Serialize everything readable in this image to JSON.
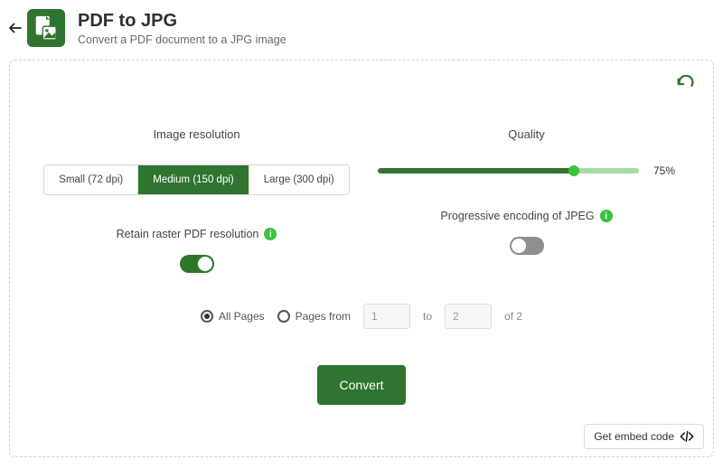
{
  "header": {
    "title": "PDF to JPG",
    "subtitle": "Convert a PDF document to a JPG image"
  },
  "resolution": {
    "label": "Image resolution",
    "options": [
      "Small (72 dpi)",
      "Medium (150 dpi)",
      "Large (300 dpi)"
    ],
    "selected_index": 1,
    "retain_label": "Retain raster PDF resolution",
    "retain_on": true
  },
  "quality": {
    "label": "Quality",
    "percent": 75,
    "percent_display": "75%",
    "progressive_label": "Progressive encoding of JPEG",
    "progressive_on": false
  },
  "pages": {
    "all_label": "All Pages",
    "range_label": "Pages from",
    "to_label": "to",
    "of_label": "of 2",
    "mode": "all",
    "from": "1",
    "to": "2",
    "total": 2
  },
  "actions": {
    "convert": "Convert",
    "embed": "Get embed code"
  }
}
